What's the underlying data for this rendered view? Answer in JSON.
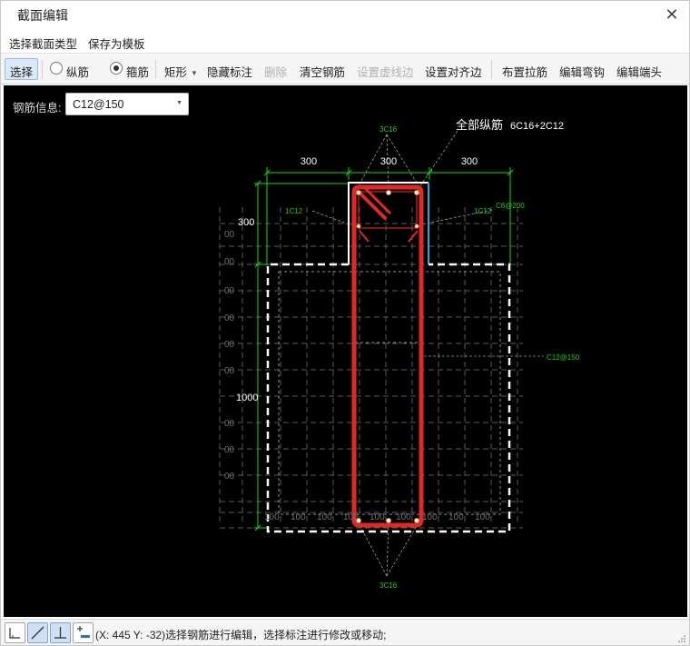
{
  "window": {
    "title": "截面编辑"
  },
  "menu": {
    "select_section_type": "选择截面类型",
    "save_as_template": "保存为模板"
  },
  "toolbar": {
    "select": "选择",
    "longitudinal": "纵筋",
    "stirrup": "箍筋",
    "rect": "矩形",
    "hide_dims": "隐藏标注",
    "delete": "删除",
    "clear_rebar": "清空钢筋",
    "set_dashed_edge": "设置虚线边",
    "set_align_edge": "设置对齐边",
    "place_tie": "布置拉筋",
    "edit_hook": "编辑弯钩",
    "edit_end": "编辑端头",
    "longitudinal_checked": false,
    "stirrup_checked": true
  },
  "rebar_info": {
    "label": "钢筋信息:",
    "value": "C12@150"
  },
  "drawing": {
    "top_dims": [
      "300",
      "300",
      "300"
    ],
    "left_dim_top": "300",
    "left_dim_main": "1000",
    "bottom_dims": [
      "100",
      "100",
      "100",
      "100",
      "100",
      "100",
      "100",
      "100",
      "100"
    ],
    "left_axis_labels": [
      "00",
      "00",
      "00",
      "00",
      "00",
      "00",
      "00",
      "00",
      "00"
    ],
    "all_long_label": "全部纵筋",
    "all_long_value": "6C16+2C12",
    "top_bar_label": "3C16",
    "bottom_bar_label": "3C16",
    "left_side_label": "1C12",
    "right_side_label": "1C12",
    "stirrup_top_label": "C6@200",
    "stirrup_main_label": "C12@150"
  },
  "status": {
    "coord": "(X: 445 Y: -32)",
    "message": "选择钢筋进行编辑，选择标注进行修改或移动;"
  },
  "colors": {
    "canvas_bg": "#000000",
    "dim_green": "#19d219",
    "rebar_red": "#e02828",
    "highlight_blue": "#1fa7e8",
    "outline_white": "#ffffff"
  }
}
